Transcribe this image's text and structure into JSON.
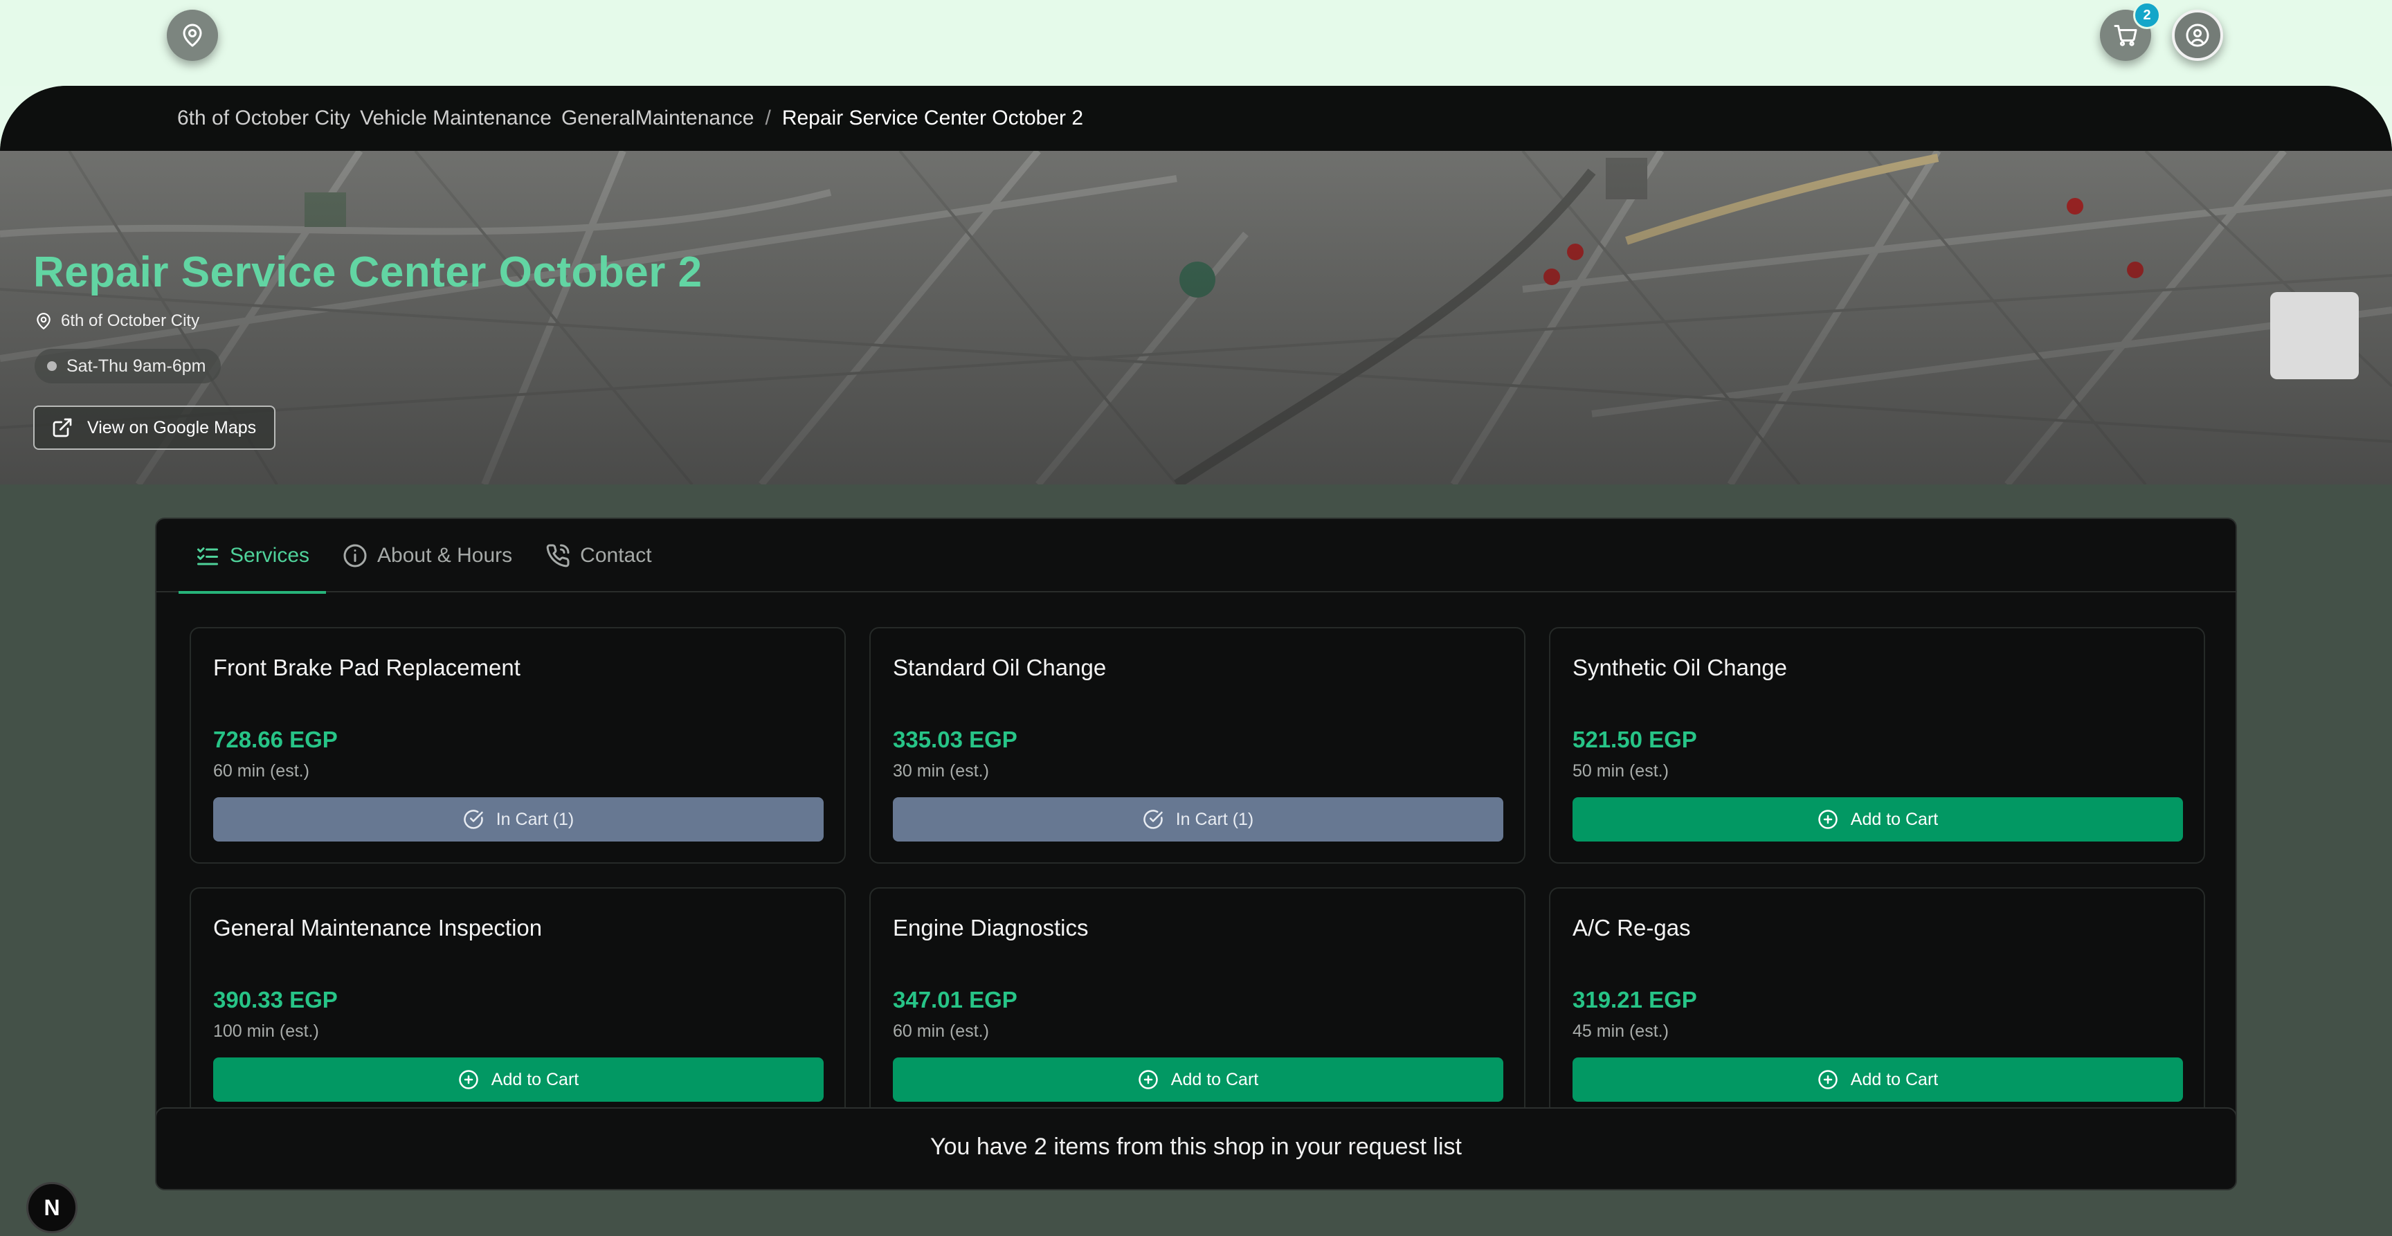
{
  "header": {
    "location_icon": "map-pin-icon",
    "cart_icon": "cart-icon",
    "cart_count": "2",
    "user_icon": "user-circle-icon"
  },
  "breadcrumb": {
    "items": [
      "6th of October City",
      "Vehicle Maintenance",
      "GeneralMaintenance"
    ],
    "separator": "/",
    "current": "Repair Service Center October 2"
  },
  "hero": {
    "title": "Repair Service Center October 2",
    "location": "6th of October City",
    "hours": "Sat-Thu 9am-6pm",
    "maps_button": "View on Google Maps"
  },
  "tabs": [
    {
      "label": "Services",
      "icon": "checklist-icon",
      "active": true
    },
    {
      "label": "About & Hours",
      "icon": "info-icon",
      "active": false
    },
    {
      "label": "Contact",
      "icon": "phone-icon",
      "active": false
    }
  ],
  "services": [
    {
      "name": "Front Brake Pad Replacement",
      "price": "728.66 EGP",
      "duration": "60 min (est.)",
      "button": "In Cart (1)",
      "in_cart": true
    },
    {
      "name": "Standard Oil Change",
      "price": "335.03 EGP",
      "duration": "30 min (est.)",
      "button": "In Cart (1)",
      "in_cart": true
    },
    {
      "name": "Synthetic Oil Change",
      "price": "521.50 EGP",
      "duration": "50 min (est.)",
      "button": "Add to Cart",
      "in_cart": false
    },
    {
      "name": "General Maintenance Inspection",
      "price": "390.33 EGP",
      "duration": "100 min (est.)",
      "button": "Add to Cart",
      "in_cart": false
    },
    {
      "name": "Engine Diagnostics",
      "price": "347.01 EGP",
      "duration": "60 min (est.)",
      "button": "Add to Cart",
      "in_cart": false
    },
    {
      "name": "A/C Re-gas",
      "price": "319.21 EGP",
      "duration": "45 min (est.)",
      "button": "Add to Cart",
      "in_cart": false
    }
  ],
  "notice": "You have 2 items from this shop in your request list",
  "dev_badge": "N",
  "colors": {
    "accent": "#27c487",
    "add_button": "#029863",
    "in_cart_button": "#677892",
    "title_green": "#62d5a3",
    "badge_blue": "#14a6c9"
  }
}
